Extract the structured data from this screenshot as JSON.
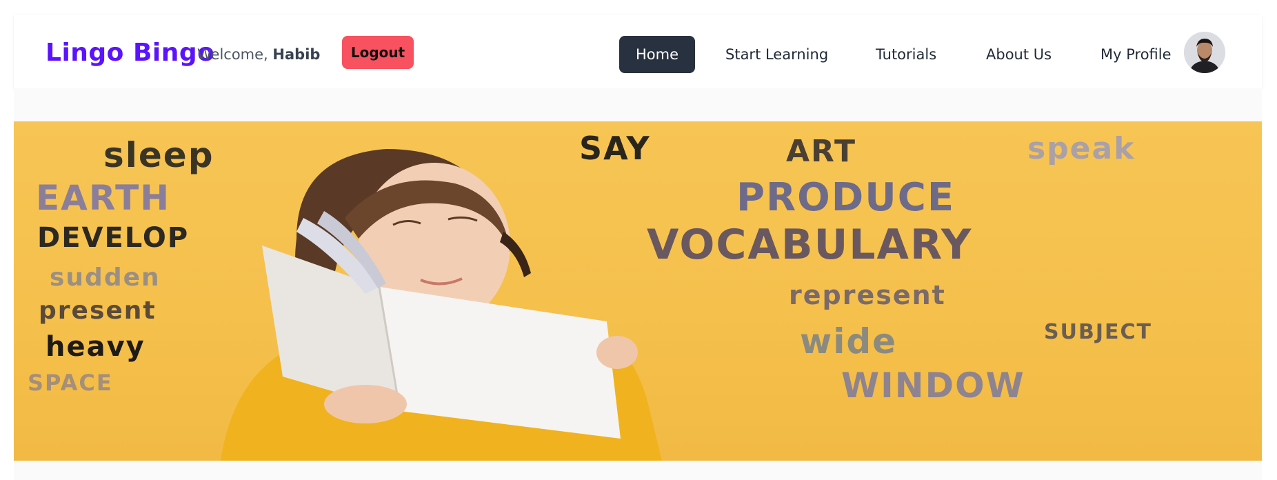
{
  "brand": "Lingo Bingo",
  "welcome": {
    "prefix": "Welcome, ",
    "user": "Habib"
  },
  "logout_label": "Logout",
  "nav": [
    {
      "label": "Home",
      "active": true
    },
    {
      "label": "Start Learning",
      "active": false
    },
    {
      "label": "Tutorials",
      "active": false
    },
    {
      "label": "About Us",
      "active": false
    },
    {
      "label": "My Profile",
      "active": false
    }
  ],
  "banner_words": [
    {
      "text": "sleep",
      "color": "#3a3425"
    },
    {
      "text": "EARTH",
      "color": "#8a7e9a"
    },
    {
      "text": "DEVELOP",
      "color": "#2c2822"
    },
    {
      "text": "sudden",
      "color": "#9b8f84"
    },
    {
      "text": "present",
      "color": "#5a4a3a"
    },
    {
      "text": "heavy",
      "color": "#1e1a16"
    },
    {
      "text": "SPACE",
      "color": "#a58f7a"
    },
    {
      "text": "SAY",
      "color": "#2a251c"
    },
    {
      "text": "ART",
      "color": "#4a3f33"
    },
    {
      "text": "speak",
      "color": "#a9a0a8"
    },
    {
      "text": "PRODUCE",
      "color": "#6e6a8a"
    },
    {
      "text": "VOCABULARY",
      "color": "#6a5860"
    },
    {
      "text": "represent",
      "color": "#7a6a6a"
    },
    {
      "text": "SUBJECT",
      "color": "#6a5e52"
    },
    {
      "text": "wide",
      "color": "#8a8a80"
    },
    {
      "text": "WINDOW",
      "color": "#8e8390"
    }
  ],
  "colors": {
    "brand": "#5b13ff",
    "logout": "#f8515f",
    "nav_active": "#28313f",
    "banner": "#f6c24f"
  },
  "icons": {
    "avatar": "user-avatar"
  }
}
